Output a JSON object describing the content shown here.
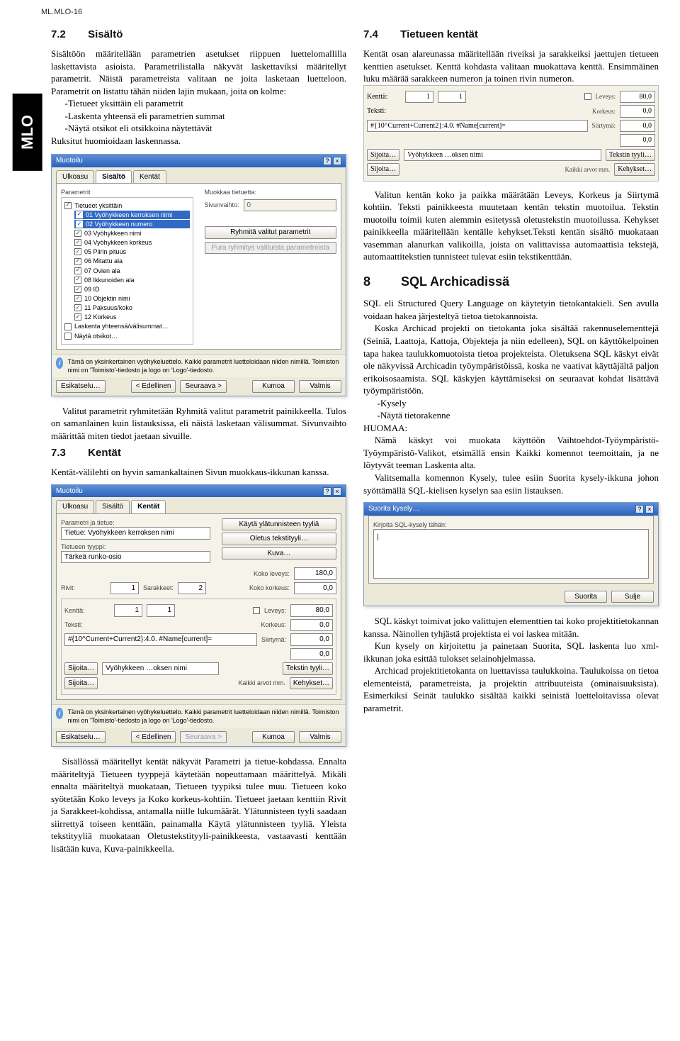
{
  "header": {
    "doc_id": "ML.MLO-16"
  },
  "side_tab": "MLO",
  "s72": {
    "num": "7.2",
    "title": "Sisältö",
    "p1": "Sisältöön määritellään parametrien asetukset riippuen luettelomallilla laskettavista asioista. Parametrilistalla näkyvät laskettaviksi määritellyt parametrit. Näistä parametreista valitaan ne joita lasketaan luetteloon. Parametrit on listattu tähän niiden lajin mukaan, joita on kolme:",
    "b1": "-Tietueet yksittäin eli parametrit",
    "b2": "-Laskenta yhteensä eli parametrien summat",
    "b3": "-Näytä otsikot eli otsikkoina näytettävät",
    "p2": "Ruksitut huomioidaan laskennassa.",
    "after1": "Valitut parametrit ryhmitetään Ryhmitä valitut parametrit painikkeella. Tulos on samanlainen kuin listauksissa, eli näistä lasketaan välisummat. Sivunvaihto määrittää miten tiedot jaetaan sivuille."
  },
  "s73": {
    "num": "7.3",
    "title": "Kentät",
    "p1": "Kentät-välilehti on hyvin samankaltainen Sivun muokkaus-ikkunan kanssa.",
    "after1": "Sisällössä määritellyt kentät näkyvät Parametri ja tietue-kohdassa. Ennalta määriteltyjä Tietueen tyyppejä käytetään nopeuttamaan määrittelyä. Mikäli ennalta määriteltyä muokataan, Tietueen tyypiksi tulee muu. Tietueen koko syötetään Koko leveys ja Koko korkeus-kohtiin. Tietueet jaetaan kenttiin Rivit ja Sarakkeet-kohdissa, antamalla niille lukumäärät. Ylätunnisteen tyyli saadaan siirrettyä toiseen kenttään, painamalla Käytä ylätunnisteen tyyliä. Yleista tekstityyliä muokataan Oletustekstityyli-painikkeesta, vastaavasti kenttään lisätään kuva, Kuva-painikkeella."
  },
  "s74": {
    "num": "7.4",
    "title": "Tietueen kentät",
    "p1": "Kentät osan alareunassa määritellään riveiksi ja sarakkeiksi jaettujen tietueen kenttien asetukset. Kenttä kohdasta valitaan muokattava kenttä. Ensimmäinen luku määrää sarakkeen numeron ja toinen rivin numeron.",
    "after1": "Valitun kentän koko ja paikka määrätään Leveys, Korkeus ja Siirtymä kohtiin. Teksti painikkeesta muutetaan kentän tekstin muotoilua. Tekstin muotoilu toimii kuten aiemmin esitetyssä oletustekstin muotoilussa. Kehykset painikkeella määritellään kentälle kehykset.Teksti kentän sisältö muokataan vasemman alanurkan valikoilla, joista on valittavissa automaattisia tekstejä, automaattitekstien tunnisteet tulevat esiin tekstikenttään."
  },
  "s8": {
    "num": "8",
    "title": "SQL Archicadissä",
    "p1": "SQL eli Structured Query Language on käytetyin tietokantakieli. Sen avulla voidaan hakea järjesteltyä tietoa tietokannoista.",
    "p2": "Koska Archicad projekti on tietokanta joka sisältää rakennuselementtejä (Seiniä, Laattoja, Kattoja, Objekteja ja niin edelleen), SQL on käyttökelpoinen tapa hakea taulukkomuotoista tietoa projekteista. Oletuksena SQL käskyt eivät ole näkyvissä Archicadin työympäristöissä, koska ne vaativat käyttäjältä paljon erikoisosaamista. SQL käskyjen käyttämiseksi on seuraavat kohdat lisättävä työympäristöön.",
    "b1": "-Kysely",
    "b2": "-Näytä tietorakenne",
    "p3": "HUOMAA:",
    "p4": "Nämä käskyt voi muokata käyttöön Vaihtoehdot-Työympäristö-Työympäristö-Valikot, etsimällä ensin Kaikki komennot teemoittain, ja ne löytyvät teeman Laskenta alta.",
    "p5": "Valitsemalla komennon Kysely, tulee esiin Suorita kysely-ikkuna johon syöttämällä SQL-kielisen kyselyn saa esiin listauksen.",
    "after1": "SQL käskyt toimivat joko valittujen elementtien tai koko projektitietokannan kanssa. Näinollen tyhjästä projektista ei voi laskea mitään.",
    "after2": "Kun kysely on kirjoitettu ja painetaan Suorita, SQL laskenta luo xml-ikkunan joka esittää tulokset selainohjelmassa.",
    "after3": "Archicad projektitietokanta on luettavissa taulukkoina. Taulukoissa on tietoa elementeistä, parametreista, ja projektin attribuuteista (ominaisuuksista). Esimerkiksi Seinät taulukko sisältää kaikki seinistä luetteloitavissa olevat parametrit."
  },
  "dlg1": {
    "title": "Muotoilu",
    "tabs": [
      "Ulkoasu",
      "Sisältö",
      "Kentät"
    ],
    "group_params": "Parametrit",
    "edit_record": "Muokkaa tietuetta:",
    "pagebreak": "Sivunvaihto:",
    "group_btn": "Ryhmitä valitut parametrit",
    "ungroup_btn": "Pura ryhmitys valituista parametreista",
    "items_head": "Tietueet yksittäin",
    "items": [
      {
        "label": "01 Vyöhykkeen kerroksen nimi",
        "on": true,
        "hl": true
      },
      {
        "label": "02 Vyöhykkeen numero",
        "on": true,
        "hl": true
      },
      {
        "label": "03 Vyöhykkeen nimi",
        "on": true
      },
      {
        "label": "04 Vyöhykkeen korkeus",
        "on": true
      },
      {
        "label": "05 Piirin pituus",
        "on": true
      },
      {
        "label": "06 Mitattu ala",
        "on": true
      },
      {
        "label": "07 Ovien ala",
        "on": true
      },
      {
        "label": "08 Ikkunoiden ala",
        "on": true
      },
      {
        "label": "09 ID",
        "on": true
      },
      {
        "label": "10 Objektin nimi",
        "on": true
      },
      {
        "label": "11 Paksuus/koko",
        "on": true
      },
      {
        "label": "12 Korkeus",
        "on": true
      }
    ],
    "sum": "Laskenta yhteensä/välisummat…",
    "show": "Näytä otsikot…",
    "info": "Tämä on yksinkertainen vyöhykeluettelo. Kaikki parametrit luetteloidaan niiden nimillä. Toimiston nimi on 'Toimisto'-tiedosto ja logo on 'Logo'-tiedosto.",
    "btn_preview": "Esikatselu…",
    "btn_prev": "< Edellinen",
    "btn_next": "Seuraava >",
    "btn_cancel": "Kumoa",
    "btn_ok": "Valmis"
  },
  "dlg2": {
    "title": "Muotoilu",
    "tabs": [
      "Ulkoasu",
      "Sisältö",
      "Kentät"
    ],
    "lbl_param": "Parametri ja tietue:",
    "val_param": "Tietue: Vyöhykkeen kerroksen nimi",
    "lbl_type": "Tietueen tyyppi:",
    "val_type": "Tärkeä runko-osio",
    "btn_header": "Käytä ylätunnisteen tyyliä",
    "btn_style": "Oletus tekstityyli…",
    "btn_image": "Kuva…",
    "lbl_kokolev": "Koko leveys:",
    "val_kokolev": "180,0",
    "lbl_kokokor": "Koko korkeus:",
    "val_kokokor": "0,0",
    "lbl_rivit": "Rivit:",
    "val_rivit": "1",
    "lbl_sarak": "Sarakkeet:",
    "val_sarak": "2",
    "lbl_kentta": "Kenttä:",
    "val_kentta_a": "1",
    "val_kentta_b": "1",
    "lbl_leveys": "Leveys:",
    "val_leveys": "80,0",
    "lbl_teksti": "Teksti:",
    "val_teksti": "#{10^Current+Current2}:4.0. #Name[current]=",
    "lbl_kork": "Korkeus:",
    "val_kork": "0,0",
    "lbl_siir": "Siirtymä:",
    "val_siir": "0,0",
    "lbl_sijoita": "Sijoita…",
    "val_vyoh": "Vyöhykkeen …oksen nimi",
    "lbl_kaikki": "Kaikki arvot mm.",
    "btn_tekstin": "Tekstin tyyli…",
    "btn_kehyk": "Kehykset…",
    "info": "Tämä on yksinkertainen vyöhykeluettelo. Kaikki parametrit luetteloidaan niiden nimillä. Toimiston nimi on 'Toimisto'-tiedosto ja logo on 'Logo'-tiedosto.",
    "btn_preview": "Esikatselu…",
    "btn_prev": "< Edellinen",
    "btn_next": "Seuraava >",
    "btn_cancel": "Kumoa",
    "btn_ok": "Valmis"
  },
  "grid74": {
    "lbl_kentta": "Kenttä:",
    "v1": "1",
    "v2": "1",
    "lbl_leveys": "Leveys:",
    "val_leveys": "80,0",
    "lbl_teksti": "Teksti:",
    "val_teksti": "#{10^Current+Current2}:4.0. #Name[current]=",
    "lbl_kork": "Korkeus:",
    "val_kork": "0,0",
    "lbl_siir": "Siirtymä:",
    "val_siir": "0,0",
    "lbl_var": "0,0",
    "lbl_sijoita": "Sijoita…",
    "val_vyoh": "Vyöhykkeen …oksen nimi",
    "lbl_kaikki": "Kaikki arvot mm.",
    "btn_tekstin": "Tekstin tyyli…",
    "btn_kehyk": "Kehykset…"
  },
  "sql_dlg": {
    "title": "Suorita kysely…",
    "label": "Kirjoita SQL-kysely tähän:",
    "value": "|",
    "btn_run": "Suorita",
    "btn_close": "Sulje"
  }
}
